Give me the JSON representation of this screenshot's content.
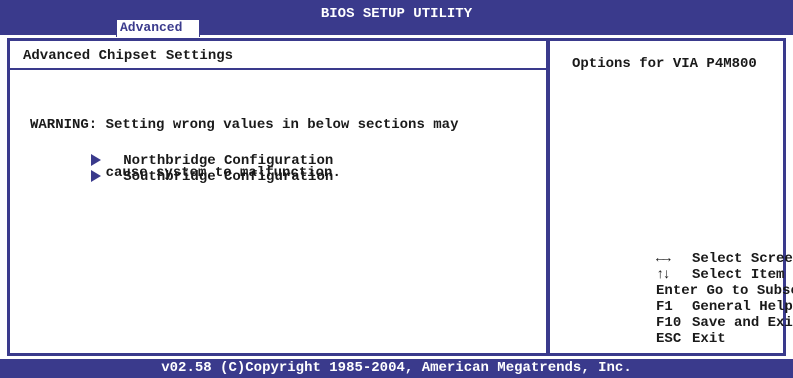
{
  "header": {
    "title": "BIOS SETUP UTILITY",
    "active_tab": "Advanced"
  },
  "main": {
    "section_title": "Advanced Chipset Settings",
    "warning_line1": "WARNING: Setting wrong values in below sections may",
    "warning_line2": "         cause system to malfunction.",
    "menu_items": [
      {
        "label": "Northbridge Configuration",
        "icon": "triangle-right-icon"
      },
      {
        "label": "Southbridge Configuration",
        "icon": "triangle-right-icon"
      }
    ]
  },
  "help": {
    "description": "Options for VIA P4M800",
    "keys": [
      {
        "key": "←→",
        "action": "Select Screen",
        "icon": "left-right-arrows-icon"
      },
      {
        "key": "↑↓",
        "action": "Select Item",
        "icon": "up-down-arrows-icon"
      },
      {
        "key": "Enter",
        "action": "Go to Subscreen"
      },
      {
        "key": "F1",
        "action": "General Help"
      },
      {
        "key": "F10",
        "action": "Save and Exit"
      },
      {
        "key": "ESC",
        "action": "Exit"
      }
    ]
  },
  "footer": {
    "copyright": "v02.58 (C)Copyright 1985-2004, American Megatrends, Inc."
  },
  "colors": {
    "accent": "#3a3a8c",
    "background": "#ffffff",
    "text": "#1a1a1a"
  }
}
